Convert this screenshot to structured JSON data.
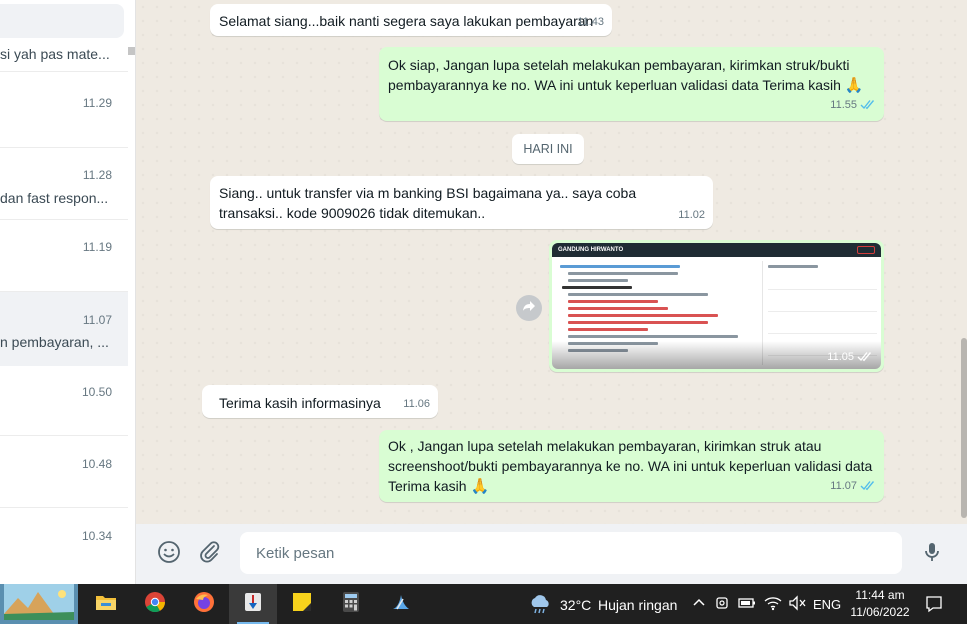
{
  "sidebar": {
    "chats": [
      {
        "time": "",
        "preview": "si yah pas mate..."
      },
      {
        "time": "11.29",
        "preview": ""
      },
      {
        "time": "11.28",
        "preview": "dan fast respon..."
      },
      {
        "time": "11.19",
        "preview": ""
      },
      {
        "time": "11.07",
        "preview": "n pembayaran, ..."
      },
      {
        "time": "10.50",
        "preview": ""
      },
      {
        "time": "10.48",
        "preview": ""
      },
      {
        "time": "10.34",
        "preview": ""
      }
    ]
  },
  "messages": [
    {
      "direction": "in",
      "text": "Selamat siang...baik nanti segera saya lakukan pembayaran",
      "time": "11.43"
    },
    {
      "direction": "out",
      "text": "Ok siap, Jangan lupa setelah melakukan pembayaran, kirimkan struk/bukti pembayarannya ke no. WA ini untuk keperluan validasi data Terima kasih",
      "emoji": "🙏",
      "time": "11.55",
      "status": "read"
    },
    {
      "direction": "in",
      "text": "Siang.. untuk transfer via m banking BSI bagaimana ya.. saya coba transaksi.. kode 9009026 tidak ditemukan..",
      "time": "11.02"
    },
    {
      "direction": "in",
      "text": "Terima kasih informasinya",
      "time": "11.06"
    },
    {
      "direction": "out",
      "text": "Ok , Jangan lupa setelah melakukan pembayaran, kirimkan struk atau screenshoot/bukti pembayarannya ke no. WA ini untuk keperluan validasi data Terima kasih",
      "emoji": "🙏",
      "time": "11.07",
      "status": "read"
    }
  ],
  "day_divider": "HARI INI",
  "image_message": {
    "header_name": "GANDUNG HIRWANTO",
    "time": "11.05",
    "status": "read"
  },
  "composer": {
    "placeholder": "Ketik pesan",
    "icons": [
      "emoji-icon",
      "attach-icon",
      "mic-icon"
    ]
  },
  "taskbar": {
    "weather_temp": "32°C",
    "weather_text": "Hujan ringan",
    "language": "ENG",
    "time": "11:44 am",
    "date": "11/06/2022",
    "apps": [
      "file-explorer-icon",
      "chrome-icon",
      "firefox-icon",
      "app-icon",
      "sticky-notes-icon",
      "calculator-icon",
      "snipping-tool-icon"
    ]
  },
  "colors": {
    "outgoing_bubble": "#d9fdd3",
    "incoming_bubble": "#ffffff",
    "chat_background": "#efeae2",
    "read_tick": "#53bdeb",
    "taskbar": "#202020"
  }
}
